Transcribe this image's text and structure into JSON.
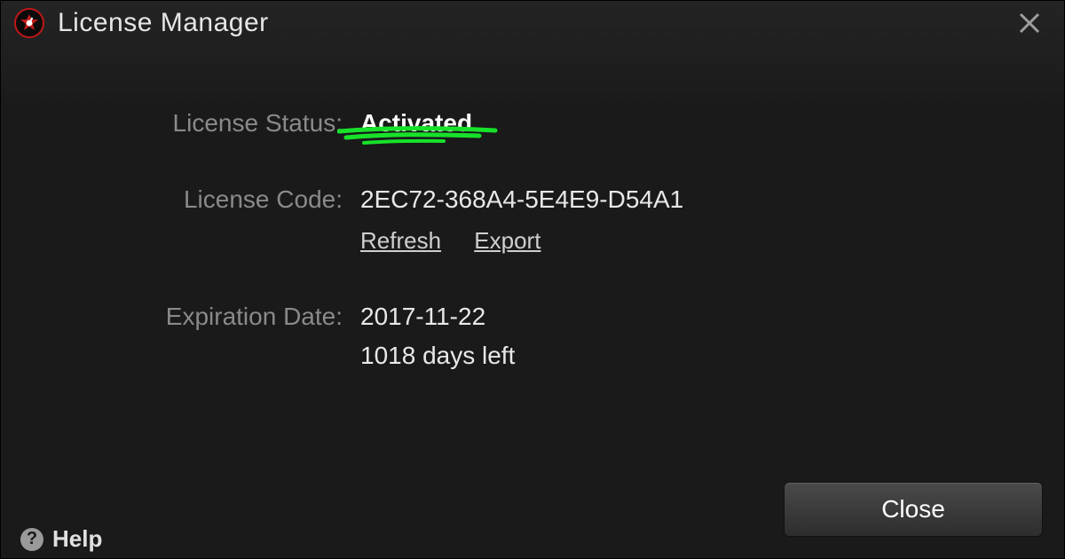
{
  "window": {
    "title": "License Manager"
  },
  "labels": {
    "status": "License Status:",
    "code": "License Code:",
    "expiration": "Expiration Date:"
  },
  "values": {
    "status": "Activated",
    "code": "2EC72-368A4-5E4E9-D54A1",
    "expiration_date": "2017-11-22",
    "days_left": "1018 days left"
  },
  "actions": {
    "refresh": "Refresh",
    "export": "Export",
    "close": "Close",
    "help": "Help"
  },
  "colors": {
    "highlight": "#17e22a"
  }
}
